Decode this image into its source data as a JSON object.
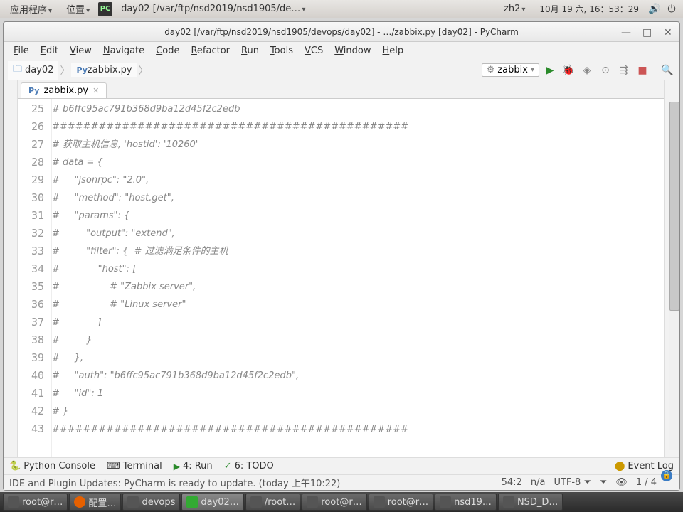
{
  "topbar": {
    "apps": "应用程序",
    "places": "位置",
    "apptitle": "day02 [/var/ftp/nsd2019/nsd1905/de…",
    "lang": "zh2",
    "date": "10月 19 六, 16：53：29"
  },
  "window": {
    "title": "day02 [/var/ftp/nsd2019/nsd1905/devops/day02] - …/zabbix.py [day02] - PyCharm"
  },
  "menu": [
    "File",
    "Edit",
    "View",
    "Navigate",
    "Code",
    "Refactor",
    "Run",
    "Tools",
    "VCS",
    "Window",
    "Help"
  ],
  "breadcrumb": {
    "folder": "day02",
    "file": "zabbix.py"
  },
  "runconfig": "zabbix",
  "tab": {
    "name": "zabbix.py"
  },
  "lines": [
    {
      "n": "25",
      "t": "# b6ffc95ac791b368d9ba12d45f2c2edb"
    },
    {
      "n": "26",
      "t": "##############################################"
    },
    {
      "n": "27",
      "t": "# 获取主机信息, 'hostid': '10260'"
    },
    {
      "n": "28",
      "t": "# data = {"
    },
    {
      "n": "29",
      "t": "#     \"jsonrpc\": \"2.0\","
    },
    {
      "n": "30",
      "t": "#     \"method\": \"host.get\","
    },
    {
      "n": "31",
      "t": "#     \"params\": {"
    },
    {
      "n": "32",
      "t": "#         \"output\": \"extend\","
    },
    {
      "n": "33",
      "t": "#         \"filter\": {  # 过滤满足条件的主机"
    },
    {
      "n": "34",
      "t": "#             \"host\": ["
    },
    {
      "n": "35",
      "t": "#                 # \"Zabbix server\","
    },
    {
      "n": "36",
      "t": "#                 # \"Linux server\""
    },
    {
      "n": "37",
      "t": "#             ]"
    },
    {
      "n": "38",
      "t": "#         }"
    },
    {
      "n": "39",
      "t": "#     },"
    },
    {
      "n": "40",
      "t": "#     \"auth\": \"b6ffc95ac791b368d9ba12d45f2c2edb\","
    },
    {
      "n": "41",
      "t": "#     \"id\": 1"
    },
    {
      "n": "42",
      "t": "# }"
    },
    {
      "n": "43",
      "t": "##############################################"
    }
  ],
  "bottom": {
    "console": "Python Console",
    "terminal": "Terminal",
    "run": "4: Run",
    "todo": "6: TODO",
    "eventlog": "Event Log"
  },
  "status": {
    "msg": "IDE and Plugin Updates: PyCharm is ready to update. (today 上午10:22)",
    "pos": "54:2",
    "na": "n/a",
    "enc": "UTF-8",
    "count": "1 / 4"
  },
  "taskbar": [
    "root@r…",
    "配置…",
    "devops",
    "day02…",
    "/root…",
    "root@r…",
    "root@r…",
    "nsd19…",
    "NSD_D…"
  ]
}
